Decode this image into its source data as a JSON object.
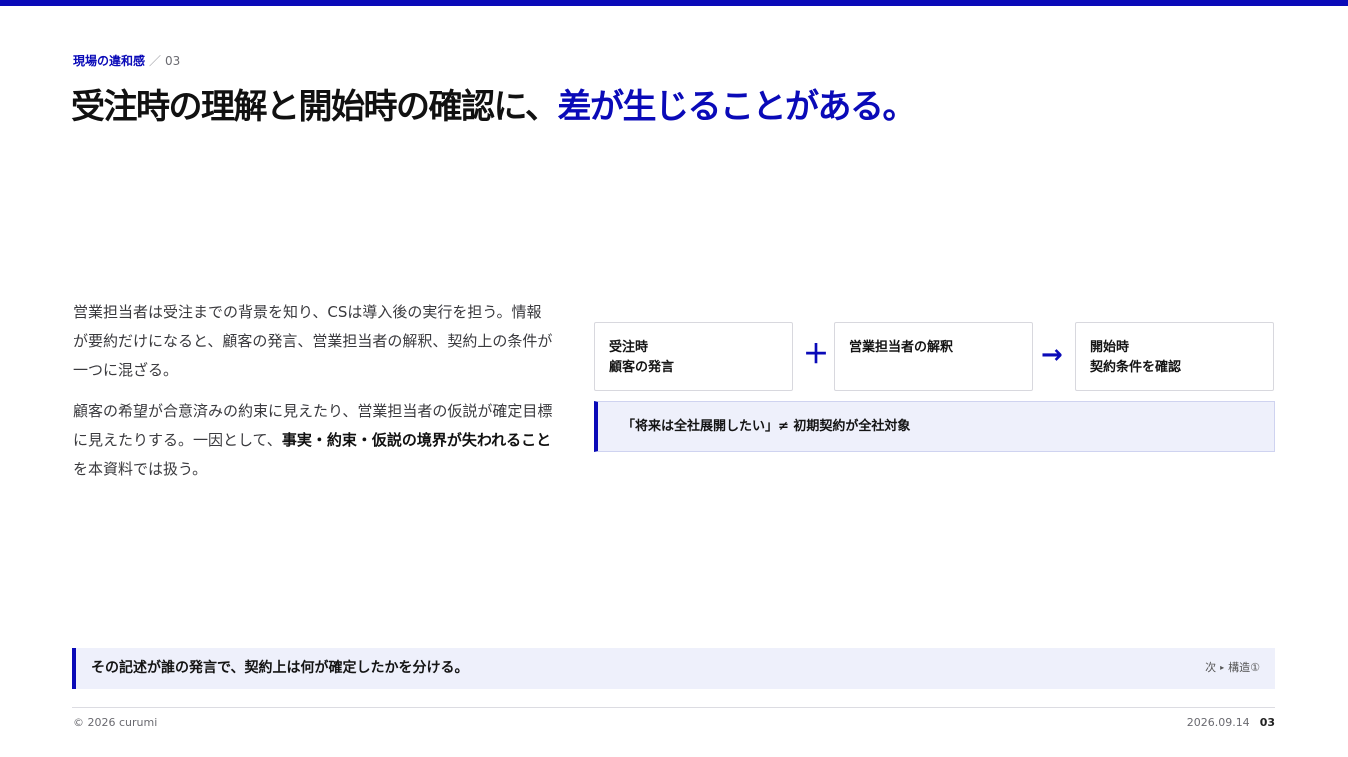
{
  "header": {
    "section": "現場の違和感",
    "separator": "／",
    "slide_no": "03"
  },
  "title": {
    "plain": "受注時の理解と開始時の確認に、",
    "highlight": "差が生じることがある。"
  },
  "body": {
    "p1": "営業担当者は受注までの背景を知り、CSは導入後の実行を担う。情報が要約だけになると、顧客の発言、営業担当者の解釈、契約上の条件が一つに混ざる。",
    "p2_pre": "顧客の希望が合意済みの約束に見えたり、営業担当者の仮説が確定目標に見えたりする。一因として、",
    "p2_bold": "事実・約束・仮説の境界が失われること",
    "p2_post": "を本資料では扱う。"
  },
  "diagram": {
    "box1": {
      "line1": "受注時",
      "line2": "顧客の発言"
    },
    "op_plus": "＋",
    "box2": {
      "line1": "営業担当者の解釈"
    },
    "op_arrow": "→",
    "box3": {
      "line1": "開始時",
      "line2": "契約条件を確認"
    },
    "callout": "「将来は全社展開したい」≠ 初期契約が全社対象"
  },
  "summary": {
    "text": "その記述が誰の発言で、契約上は何が確定したかを分ける。",
    "next_label": "次",
    "next_arrow": "▸",
    "next_target": "構造①"
  },
  "footer": {
    "copyright": "© 2026 curumi",
    "date": "2026.09.14",
    "page": "03"
  },
  "colors": {
    "accent": "#0a0ab8",
    "callout_bg": "#eef0fb",
    "text": "#1a1a1a"
  }
}
